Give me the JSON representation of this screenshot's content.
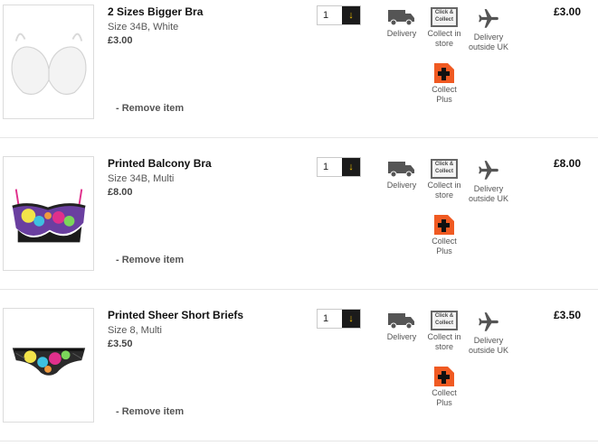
{
  "delivery_options": {
    "delivery": "Delivery",
    "collect_in_store_line1": "Collect in",
    "collect_in_store_line2": "store",
    "click_collect_badge_line1": "Click &",
    "click_collect_badge_line2": "Collect",
    "outside_uk_line1": "Delivery",
    "outside_uk_line2": "outside UK",
    "collect_plus_line1": "Collect",
    "collect_plus_line2": "Plus"
  },
  "icons": {
    "delivery": "delivery-truck-icon",
    "collect": "click-and-collect-icon",
    "outside_uk": "airplane-icon",
    "collect_plus": "collect-plus-icon",
    "qty": "chevron-down-icon"
  },
  "colors": {
    "collect_plus": "#f05a22",
    "qty_button_bg": "#1b1b1b",
    "qty_button_arrow": "#f6c300"
  },
  "remove_label": "- Remove item",
  "items": [
    {
      "title": "2 Sizes Bigger Bra",
      "meta": "Size 34B, White",
      "unit_price": "£3.00",
      "quantity": "1",
      "line_total": "£3.00"
    },
    {
      "title": "Printed Balcony Bra",
      "meta": "Size 34B, Multi",
      "unit_price": "£8.00",
      "quantity": "1",
      "line_total": "£8.00"
    },
    {
      "title": "Printed Sheer Short Briefs",
      "meta": "Size 8, Multi",
      "unit_price": "£3.50",
      "quantity": "1",
      "line_total": "£3.50"
    }
  ]
}
